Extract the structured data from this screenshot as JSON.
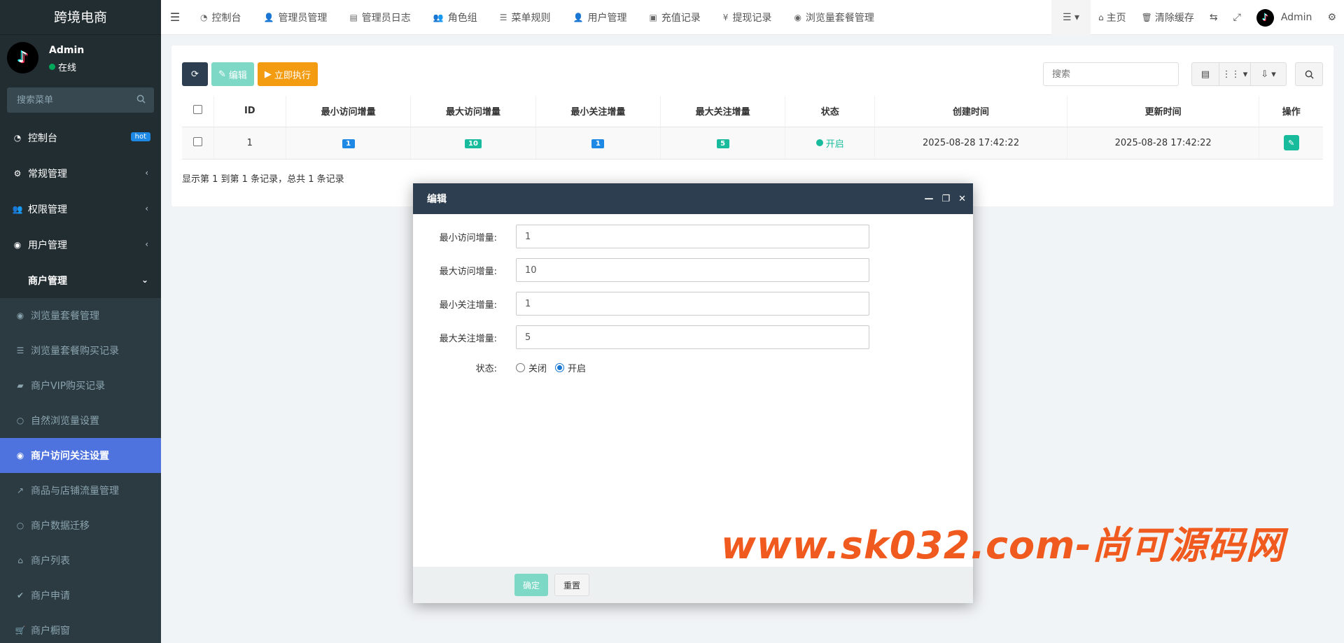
{
  "brand": "跨境电商",
  "user": {
    "name": "Admin",
    "status": "在线"
  },
  "sidebar": {
    "search_placeholder": "搜索菜单",
    "items": [
      {
        "label": "控制台",
        "badge": "hot"
      },
      {
        "label": "常规管理"
      },
      {
        "label": "权限管理"
      },
      {
        "label": "用户管理"
      },
      {
        "label": "商户管理"
      }
    ],
    "subitems": [
      {
        "label": "浏览量套餐管理"
      },
      {
        "label": "浏览量套餐购买记录"
      },
      {
        "label": "商户VIP购买记录"
      },
      {
        "label": "自然浏览量设置"
      },
      {
        "label": "商户访问关注设置"
      },
      {
        "label": "商品与店铺流量管理"
      },
      {
        "label": "商户数据迁移"
      },
      {
        "label": "商户列表"
      },
      {
        "label": "商户申请"
      },
      {
        "label": "商户橱窗"
      }
    ]
  },
  "topnav": {
    "tabs": [
      "控制台",
      "管理员管理",
      "管理员日志",
      "角色组",
      "菜单规则",
      "用户管理",
      "充值记录",
      "提现记录",
      "浏览量套餐管理"
    ],
    "home": "主页",
    "clear_cache": "清除缓存",
    "admin": "Admin"
  },
  "toolbar": {
    "edit": "编辑",
    "execute": "立即执行",
    "search_placeholder": "搜索"
  },
  "table": {
    "headers": [
      "ID",
      "最小访问增量",
      "最大访问增量",
      "最小关注增量",
      "最大关注增量",
      "状态",
      "创建时间",
      "更新时间",
      "操作"
    ],
    "rows": [
      {
        "id": "1",
        "min_visit": "1",
        "max_visit": "10",
        "min_follow": "1",
        "max_follow": "5",
        "status": "开启",
        "created": "2025-08-28 17:42:22",
        "updated": "2025-08-28 17:42:22"
      }
    ],
    "pager": "显示第 1 到第 1 条记录，总共 1 条记录"
  },
  "modal": {
    "title": "编辑",
    "fields": [
      {
        "label": "最小访问增量:",
        "value": "1"
      },
      {
        "label": "最大访问增量:",
        "value": "10"
      },
      {
        "label": "最小关注增量:",
        "value": "1"
      },
      {
        "label": "最大关注增量:",
        "value": "5"
      }
    ],
    "status_label": "状态:",
    "status_options": [
      "关闭",
      "开启"
    ],
    "selected_status": "开启",
    "ok": "确定",
    "reset": "重置"
  },
  "watermark": "www.sk032.com-尚可源码网",
  "colors": {
    "sidebar": "#222d32",
    "active": "#4e73df",
    "primary": "#1e88e5",
    "success": "#18bc9c",
    "warning": "#f39c12",
    "header": "#2c3e50"
  }
}
